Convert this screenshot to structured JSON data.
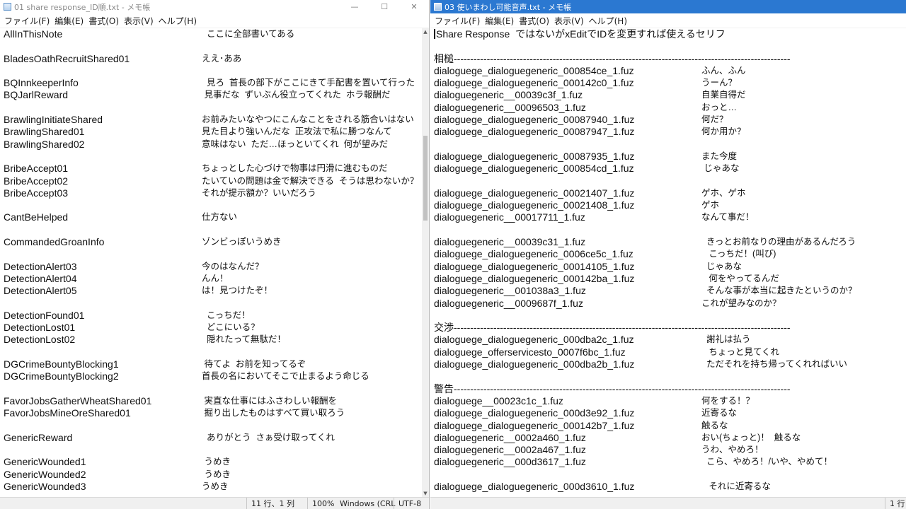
{
  "left_window": {
    "title": "01 share response_ID順.txt - メモ帳",
    "menu": [
      "ファイル(F)",
      "編集(E)",
      "書式(O)",
      "表示(V)",
      "ヘルプ(H)"
    ],
    "controls": [
      "—",
      "☐",
      "✕"
    ],
    "lines": [
      {
        "a": "AllInThisNote",
        "b": "  ここに全部書いてある"
      },
      {
        "a": "",
        "b": ""
      },
      {
        "a": "BladesOathRecruitShared01",
        "b": "ええ･ああ"
      },
      {
        "a": "",
        "b": ""
      },
      {
        "a": "BQInnkeeperInfo",
        "b": "  見ろ  首長の部下がここにきて手配書を置いて行った"
      },
      {
        "a": "BQJarlReward",
        "b": " 見事だな  ずいぶん役立ってくれた  ホラ報酬だ"
      },
      {
        "a": "",
        "b": ""
      },
      {
        "a": "BrawlingInitiateShared",
        "b": "お前みたいなやつにこんなことをされる筋合いはない"
      },
      {
        "a": "BrawlingShared01",
        "b": "見た目より強いんだな  正攻法で私に勝つなんて"
      },
      {
        "a": "BrawlingShared02",
        "b": "意味はない  ただ…ほっといてくれ  何が望みだ"
      },
      {
        "a": "",
        "b": ""
      },
      {
        "a": "BribeAccept01",
        "b": "ちょっとした心づけで物事は円滑に進むものだ"
      },
      {
        "a": "BribeAccept02",
        "b": "たいていの問題は金で解決できる  そうは思わないか？"
      },
      {
        "a": "BribeAccept03",
        "b": "それが提示額か？いいだろう"
      },
      {
        "a": "",
        "b": ""
      },
      {
        "a": "CantBeHelped",
        "b": "仕方ない"
      },
      {
        "a": "",
        "b": ""
      },
      {
        "a": "CommandedGroanInfo",
        "b": "ゾンビっぽいうめき"
      },
      {
        "a": "",
        "b": ""
      },
      {
        "a": "DetectionAlert03",
        "b": "今のはなんだ？"
      },
      {
        "a": "DetectionAlert04",
        "b": "んん！"
      },
      {
        "a": "DetectionAlert05",
        "b": "は！見つけたぞ！"
      },
      {
        "a": "",
        "b": ""
      },
      {
        "a": "DetectionFound01",
        "b": "  こっちだ！"
      },
      {
        "a": "DetectionLost01",
        "b": "  どこにいる？"
      },
      {
        "a": "DetectionLost02",
        "b": "  隠れたって無駄だ！"
      },
      {
        "a": "",
        "b": ""
      },
      {
        "a": "DGCrimeBountyBlocking1",
        "b": " 待てよ  お前を知ってるぞ"
      },
      {
        "a": "DGCrimeBountyBlocking2",
        "b": "首長の名においてそこで止まるよう命じる"
      },
      {
        "a": "",
        "b": ""
      },
      {
        "a": "FavorJobsGatherWheatShared01",
        "b": " 実直な仕事にはふさわしい報酬を"
      },
      {
        "a": "FavorJobsMineOreShared01",
        "b": " 掘り出したものはすべて買い取ろう"
      },
      {
        "a": "",
        "b": ""
      },
      {
        "a": "GenericReward",
        "b": "  ありがとう  さぁ受け取ってくれ"
      },
      {
        "a": "",
        "b": ""
      },
      {
        "a": "GenericWounded1",
        "b": " うめき"
      },
      {
        "a": "GenericWounded2",
        "b": " うめき"
      },
      {
        "a": "GenericWounded3",
        "b": "うめき"
      }
    ],
    "status": {
      "position": "11 行、1 列",
      "zoom": "100%",
      "eol": "Windows (CRL",
      "encoding": "UTF-8"
    }
  },
  "right_window": {
    "title": "03 使いまわし可能音声.txt - メモ帳",
    "menu": [
      "ファイル(F)",
      "編集(E)",
      "書式(O)",
      "表示(V)",
      "ヘルプ(H)"
    ],
    "lines": [
      {
        "a": "Share Response  ではないがxEditでIDを変更すれば使えるセリフ",
        "b": "",
        "caret": true
      },
      {
        "a": "",
        "b": ""
      },
      {
        "a": "相槌------------------------------------------------------------------------------------------------------",
        "b": ""
      },
      {
        "a": "dialoguege_dialoguegeneric_000854ce_1.fuz",
        "b": "ふん、ふん"
      },
      {
        "a": "dialoguege_dialoguegeneric_000142c0_1.fuz",
        "b": "うーん？"
      },
      {
        "a": "dialoguegeneric__00039c3f_1.fuz",
        "b": "自業自得だ"
      },
      {
        "a": "dialoguegeneric__00096503_1.fuz",
        "b": "おっと…"
      },
      {
        "a": "dialoguege_dialoguegeneric_00087940_1.fuz",
        "b": "何だ？"
      },
      {
        "a": "dialoguege_dialoguegeneric_00087947_1.fuz",
        "b": "何か用か？"
      },
      {
        "a": "",
        "b": ""
      },
      {
        "a": "dialoguege_dialoguegeneric_00087935_1.fuz",
        "b": "また今度"
      },
      {
        "a": "dialoguege_dialoguegeneric_000854cd_1.fuz",
        "b": " じゃあな"
      },
      {
        "a": "",
        "b": ""
      },
      {
        "a": "dialoguege_dialoguegeneric_00021407_1.fuz",
        "b": "ゲホ、ゲホ"
      },
      {
        "a": "dialoguege_dialoguegeneric_00021408_1.fuz",
        "b": "ゲホ"
      },
      {
        "a": "dialoguegeneric__00017711_1.fuz",
        "b": "なんて事だ！"
      },
      {
        "a": "",
        "b": ""
      },
      {
        "a": "dialoguegeneric__00039c31_1.fuz",
        "b": "  きっとお前なりの理由があるんだろう"
      },
      {
        "a": "dialoguege_dialoguegeneric_0006ce5c_1.fuz",
        "b": "   こっちだ！(叫び)"
      },
      {
        "a": "dialoguege_dialoguegeneric_00014105_1.fuz",
        "b": "  じゃあな"
      },
      {
        "a": "dialoguege_dialoguegeneric_000142ba_1.fuz",
        "b": "   何をやってるんだ"
      },
      {
        "a": "dialoguegeneric__001038a3_1.fuz",
        "b": "  そんな事が本当に起きたというのか？"
      },
      {
        "a": "dialoguegeneric__0009687f_1.fuz",
        "b": "これが望みなのか？"
      },
      {
        "a": "",
        "b": ""
      },
      {
        "a": "交渉------------------------------------------------------------------------------------------------------",
        "b": ""
      },
      {
        "a": "dialoguege_dialoguegeneric_000dba2c_1.fuz",
        "b": "  謝礼は払う"
      },
      {
        "a": "dialoguege_offerservicesto_0007f6bc_1.fuz",
        "b": "   ちょっと見てくれ"
      },
      {
        "a": "dialoguege_dialoguegeneric_000dba2b_1.fuz",
        "b": "  ただそれを持ち帰ってくれればいい"
      },
      {
        "a": "",
        "b": ""
      },
      {
        "a": "警告------------------------------------------------------------------------------------------------------",
        "b": ""
      },
      {
        "a": "dialoguege__00023c1c_1.fuz",
        "b": "何をする！？"
      },
      {
        "a": "dialoguege_dialoguegeneric_000d3e92_1.fuz",
        "b": "近寄るな"
      },
      {
        "a": "dialoguege_dialoguegeneric_000142b7_1.fuz",
        "b": "触るな"
      },
      {
        "a": "dialoguegeneric__0002a460_1.fuz",
        "b": "おい(ちょっと)！  触るな"
      },
      {
        "a": "dialoguegeneric__0002a467_1.fuz",
        "b": "うわ、やめろ！"
      },
      {
        "a": "dialoguegeneric__000d3617_1.fuz",
        "b": "  こら、やめろ！/いや、やめて！"
      },
      {
        "a": "",
        "b": ""
      },
      {
        "a": "dialoguege_dialoguegeneric_000d3610_1.fuz",
        "b": "   それに近寄るな"
      }
    ],
    "status": {
      "position": "1 行"
    }
  }
}
